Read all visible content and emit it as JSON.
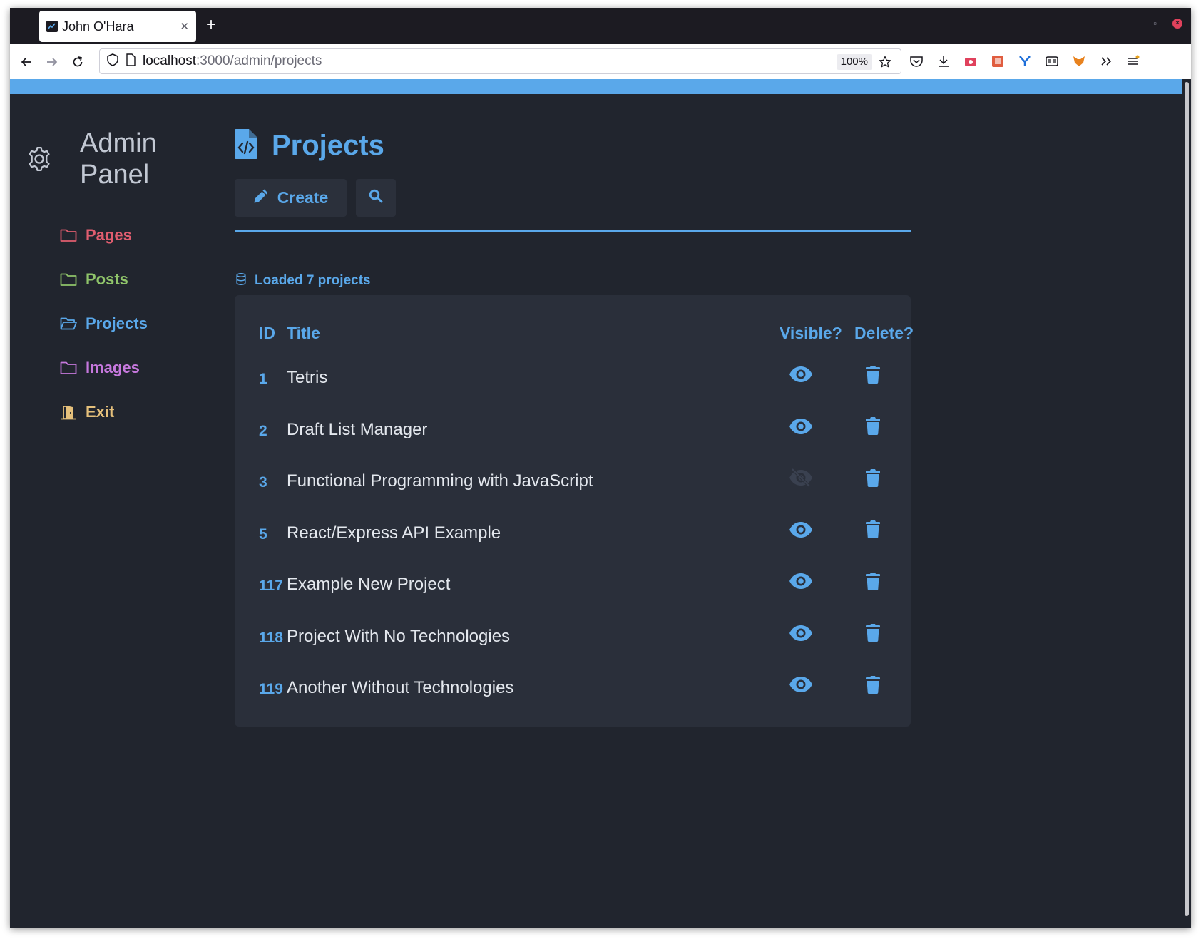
{
  "browser": {
    "tab_title": "John O'Hara",
    "new_tab_label": "+",
    "url_host": "localhost",
    "url_rest": ":3000/admin/projects",
    "zoom": "100%"
  },
  "colors": {
    "accent": "#5aa8ea",
    "background": "#21252e",
    "card": "#2a2f3a",
    "pages": "#e05d6f",
    "posts": "#8fc46a",
    "projects": "#5aa8ea",
    "images": "#c678dd",
    "exit": "#e5c07b"
  },
  "sidebar": {
    "brand_line1": "Admin",
    "brand_line2": "Panel",
    "items": [
      {
        "label": "Pages",
        "icon": "folder-icon"
      },
      {
        "label": "Posts",
        "icon": "folder-icon"
      },
      {
        "label": "Projects",
        "icon": "folder-open-icon"
      },
      {
        "label": "Images",
        "icon": "folder-icon"
      },
      {
        "label": "Exit",
        "icon": "door-exit-icon"
      }
    ]
  },
  "main": {
    "title": "Projects",
    "create_label": "Create",
    "status": "Loaded 7 projects",
    "table": {
      "headers": {
        "id": "ID",
        "title": "Title",
        "visible": "Visible?",
        "delete": "Delete?"
      },
      "rows": [
        {
          "id": "1",
          "title": "Tetris",
          "visible": true
        },
        {
          "id": "2",
          "title": "Draft List Manager",
          "visible": true
        },
        {
          "id": "3",
          "title": "Functional Programming with JavaScript",
          "visible": false
        },
        {
          "id": "5",
          "title": "React/Express API Example",
          "visible": true
        },
        {
          "id": "117",
          "title": "Example New Project",
          "visible": true
        },
        {
          "id": "118",
          "title": "Project With No Technologies",
          "visible": true
        },
        {
          "id": "119",
          "title": "Another Without Technologies",
          "visible": true
        }
      ]
    }
  }
}
